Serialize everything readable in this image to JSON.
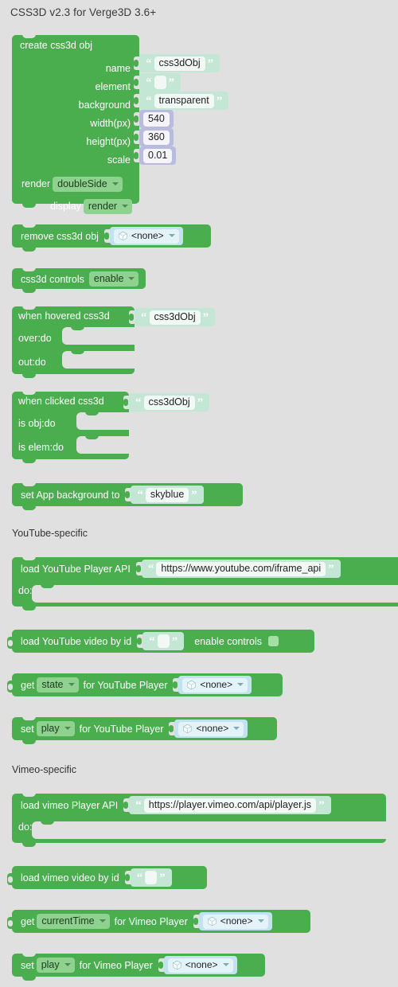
{
  "page": {
    "title": "CSS3D v2.3 for Verge3D 3.6+",
    "background_color": "#e0e0e0",
    "block_color": "#4aae4f",
    "string_block_color": "#c3e6d5",
    "number_block_color": "#b9bcdf",
    "object_block_color": "#c2e2ef",
    "dropdown_color": "#8fd18f"
  },
  "sections": {
    "youtube": "YouTube-specific",
    "vimeo": "Vimeo-specific"
  },
  "blocks": {
    "create_css3d": {
      "title": "create css3d obj",
      "fields": [
        {
          "label": "name",
          "kind": "string",
          "value": "css3dObj"
        },
        {
          "label": "element",
          "kind": "string",
          "value": ""
        },
        {
          "label": "background",
          "kind": "string",
          "value": "transparent"
        },
        {
          "label": "width(px)",
          "kind": "number",
          "value": "540"
        },
        {
          "label": "height(px)",
          "kind": "number",
          "value": "360"
        },
        {
          "label": "scale",
          "kind": "number",
          "value": "0.01"
        }
      ],
      "render_label": "render",
      "render_value": "doubleSide",
      "display_label": "display",
      "display_value": "render"
    },
    "remove_css3d": {
      "label": "remove css3d obj",
      "object_value": "<none>"
    },
    "css3d_controls": {
      "label": "css3d controls",
      "dropdown_value": "enable"
    },
    "when_hovered": {
      "label": "when hovered css3d",
      "string_value": "css3dObj",
      "slot1_label": "over:do",
      "slot2_label": "out:do"
    },
    "when_clicked": {
      "label": "when clicked css3d",
      "string_value": "css3dObj",
      "slot1_label": "is obj:do",
      "slot2_label": "is elem:do"
    },
    "set_app_background": {
      "label": "set App background  to",
      "string_value": "skyblue"
    },
    "load_youtube_api": {
      "label": "load YouTube Player API",
      "string_value": "https://www.youtube.com/iframe_api",
      "slot_label": "do:"
    },
    "load_youtube_video": {
      "label": "load YouTube video by  id",
      "string_value": "",
      "controls_label": "enable controls",
      "controls_checked": false
    },
    "get_youtube": {
      "label_pre": "get",
      "dropdown_value": "state",
      "label_post": "for YouTube Player",
      "object_value": "<none>"
    },
    "set_youtube": {
      "label_pre": "set",
      "dropdown_value": "play",
      "label_post": "for YouTube Player",
      "object_value": "<none>"
    },
    "load_vimeo_api": {
      "label": "load vimeo Player API",
      "string_value": "https://player.vimeo.com/api/player.js",
      "slot_label": "do:"
    },
    "load_vimeo_video": {
      "label": "load vimeo video by  id",
      "string_value": ""
    },
    "get_vimeo": {
      "label_pre": "get",
      "dropdown_value": "currentTime",
      "label_post": "for Vimeo Player",
      "object_value": "<none>"
    },
    "set_vimeo": {
      "label_pre": "set",
      "dropdown_value": "play",
      "label_post": "for Vimeo Player",
      "object_value": "<none>"
    }
  },
  "icons": {
    "cube": "cube-icon",
    "caret": "chevron-down-icon"
  }
}
